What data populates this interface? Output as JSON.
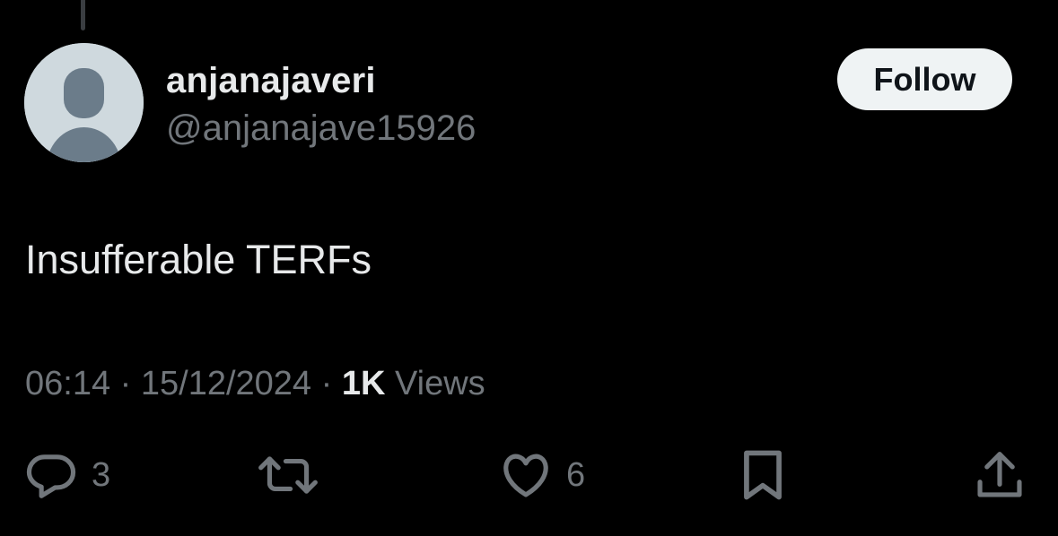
{
  "tweet": {
    "author": {
      "display_name": "anjanajaveri",
      "handle": "@anjanajave15926",
      "avatar_icon": "default-avatar-icon"
    },
    "follow_label": "Follow",
    "text": "Insufferable TERFs",
    "time": "06:14",
    "separator": "·",
    "date": "15/12/2024",
    "views_count": "1K",
    "views_label": "Views",
    "actions": {
      "reply": {
        "icon": "reply-icon",
        "count": "3"
      },
      "retweet": {
        "icon": "retweet-icon",
        "count": ""
      },
      "like": {
        "icon": "heart-icon",
        "count": "6"
      },
      "bookmark": {
        "icon": "bookmark-icon"
      },
      "share": {
        "icon": "share-icon"
      }
    }
  },
  "colors": {
    "background": "#000000",
    "primary_text": "#e7e9ea",
    "secondary_text": "#71767b",
    "button_bg": "#eff3f4",
    "button_text": "#0f1419",
    "avatar_bg": "#cfd9de",
    "avatar_fg": "#6b7c8a"
  }
}
